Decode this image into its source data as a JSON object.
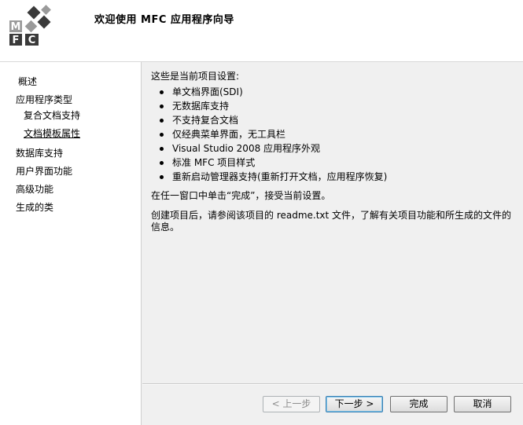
{
  "header": {
    "title": "欢迎使用 MFC 应用程序向导",
    "logo_letters": [
      "M",
      "F",
      "C"
    ]
  },
  "sidebar": {
    "items": [
      {
        "label": "概述",
        "active": false
      },
      {
        "label": "应用程序类型",
        "active": false
      },
      {
        "label": "复合文档支持",
        "active": false
      },
      {
        "label": "文档模板属性",
        "active": true
      },
      {
        "label": "数据库支持",
        "active": false
      },
      {
        "label": "用户界面功能",
        "active": false
      },
      {
        "label": "高级功能",
        "active": false
      },
      {
        "label": "生成的类",
        "active": false
      }
    ]
  },
  "content": {
    "intro": "这些是当前项目设置:",
    "settings": [
      "单文档界面(SDI)",
      "无数据库支持",
      "不支持复合文档",
      "仅经典菜单界面，无工具栏",
      "Visual Studio 2008 应用程序外观",
      "标准 MFC 项目样式",
      "重新启动管理器支持(重新打开文档，应用程序恢复)"
    ],
    "instruction": "在任一窗口中单击“完成”，接受当前设置。",
    "readme_note": "创建项目后，请参阅该项目的 readme.txt 文件，了解有关项目功能和所生成的文件的信息。"
  },
  "buttons": {
    "back": "< 上一步",
    "next": "下一步 >",
    "finish": "完成",
    "cancel": "取消"
  },
  "colors": {
    "logo_dark": "#3a3a3a",
    "logo_light": "#9a9a9a",
    "panel_bg": "#f0f0f0",
    "sidebar_bg": "#ffffff"
  }
}
